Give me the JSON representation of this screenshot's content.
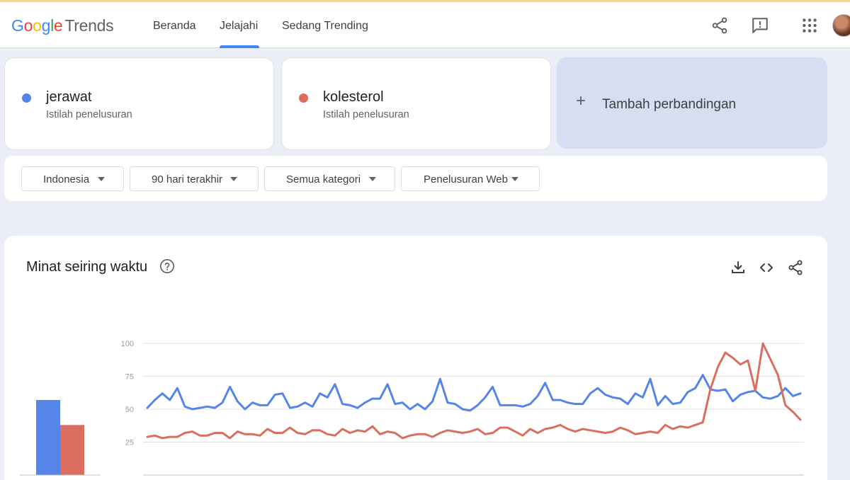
{
  "header": {
    "logo_google": "Google",
    "logo_trends": "Trends",
    "nav": [
      {
        "label": "Beranda"
      },
      {
        "label": "Jelajahi"
      },
      {
        "label": "Sedang Trending"
      }
    ],
    "active_nav": "Jelajahi",
    "icons": [
      "share-icon",
      "feedback-icon",
      "apps-grid-icon",
      "avatar"
    ]
  },
  "terms": [
    {
      "name": "jerawat",
      "sub": "Istilah penelusuran",
      "color": "#5585e8"
    },
    {
      "name": "kolesterol",
      "sub": "Istilah penelusuran",
      "color": "#da6e60"
    }
  ],
  "add_compare": {
    "label": "Tambah perbandingan"
  },
  "filters": [
    {
      "label": "Indonesia"
    },
    {
      "label": "90 hari terakhir"
    },
    {
      "label": "Semua kategori"
    },
    {
      "label": "Penelusuran Web"
    }
  ],
  "chart_card": {
    "title": "Minat seiring waktu",
    "icons": [
      "help-icon",
      "download-icon",
      "embed-code-icon",
      "share-icon"
    ]
  },
  "chart_data": {
    "type": "line",
    "ylim": [
      0,
      100
    ],
    "yticks": [
      "100",
      "75",
      "50",
      "25"
    ],
    "grid": true,
    "series": [
      {
        "name": "jerawat",
        "color": "#5585e8",
        "average": 57,
        "values": [
          51,
          57,
          62,
          57,
          66,
          52,
          50,
          51,
          52,
          51,
          55,
          67,
          56,
          50,
          55,
          53,
          53,
          61,
          62,
          51,
          52,
          55,
          52,
          62,
          59,
          69,
          54,
          53,
          51,
          55,
          58,
          58,
          69,
          54,
          55,
          50,
          54,
          50,
          56,
          73,
          55,
          54,
          50,
          49,
          53,
          59,
          67,
          53,
          53,
          53,
          52,
          54,
          60,
          70,
          57,
          57,
          55,
          54,
          54,
          62,
          66,
          61,
          59,
          58,
          54,
          62,
          59,
          73,
          53,
          60,
          54,
          55,
          63,
          66,
          76,
          65,
          64,
          65,
          56,
          61,
          63,
          64,
          59,
          58,
          60,
          66,
          60,
          62
        ],
        "color_name": "blue"
      },
      {
        "name": "kolesterol",
        "color": "#da6e60",
        "average": 38,
        "values": [
          29,
          30,
          28,
          29,
          29,
          32,
          33,
          30,
          30,
          32,
          32,
          28,
          33,
          31,
          31,
          30,
          35,
          32,
          32,
          36,
          32,
          31,
          34,
          34,
          31,
          30,
          35,
          32,
          34,
          33,
          37,
          31,
          33,
          32,
          28,
          30,
          31,
          31,
          29,
          32,
          34,
          33,
          32,
          33,
          35,
          31,
          32,
          36,
          36,
          33,
          30,
          35,
          32,
          35,
          36,
          38,
          35,
          33,
          35,
          34,
          33,
          32,
          33,
          36,
          34,
          31,
          32,
          33,
          32,
          38,
          35,
          37,
          36,
          38,
          40,
          65,
          82,
          93,
          89,
          84,
          87,
          64,
          100,
          88,
          76,
          53,
          48,
          42
        ],
        "color_name": "red"
      }
    ]
  }
}
